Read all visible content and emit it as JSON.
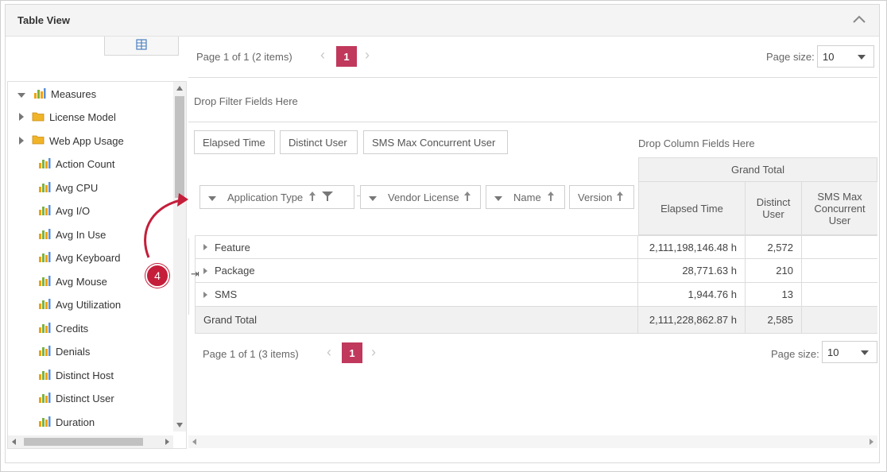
{
  "panel": {
    "title": "Table View"
  },
  "top_pager": {
    "info": "Page 1 of 1 (2 items)",
    "current_page": "1",
    "page_size_label": "Page size:",
    "page_size_value": "10"
  },
  "tree": {
    "items": [
      {
        "label": "Measures",
        "kind": "root-expanded",
        "icon": "bar-chart-icon"
      },
      {
        "label": "License Model",
        "kind": "folder",
        "icon": "folder-icon"
      },
      {
        "label": "Web App Usage",
        "kind": "folder",
        "icon": "folder-icon"
      },
      {
        "label": "Action Count",
        "kind": "measure",
        "icon": "bar-chart-icon"
      },
      {
        "label": "Avg CPU",
        "kind": "measure",
        "icon": "bar-chart-icon"
      },
      {
        "label": "Avg I/O",
        "kind": "measure",
        "icon": "bar-chart-icon"
      },
      {
        "label": "Avg In Use",
        "kind": "measure",
        "icon": "bar-chart-icon"
      },
      {
        "label": "Avg Keyboard",
        "kind": "measure",
        "icon": "bar-chart-icon"
      },
      {
        "label": "Avg Mouse",
        "kind": "measure",
        "icon": "bar-chart-icon"
      },
      {
        "label": "Avg Utilization",
        "kind": "measure",
        "icon": "bar-chart-icon"
      },
      {
        "label": "Credits",
        "kind": "measure",
        "icon": "bar-chart-icon"
      },
      {
        "label": "Denials",
        "kind": "measure",
        "icon": "bar-chart-icon"
      },
      {
        "label": "Distinct Host",
        "kind": "measure",
        "icon": "bar-chart-icon"
      },
      {
        "label": "Distinct User",
        "kind": "measure",
        "icon": "bar-chart-icon"
      },
      {
        "label": "Duration",
        "kind": "measure",
        "icon": "bar-chart-icon"
      }
    ]
  },
  "pivot": {
    "filter_drop": "Drop Filter Fields Here",
    "data_fields": [
      "Elapsed Time",
      "Distinct User",
      "SMS Max Concurrent User"
    ],
    "column_drop": "Drop Column Fields Here",
    "row_fields": [
      "Application Type",
      "Vendor License",
      "Name",
      "Version"
    ],
    "grand_total_header": "Grand Total",
    "column_headers": [
      "Elapsed Time",
      "Distinct User",
      "SMS Max Concurrent User"
    ],
    "rows": [
      {
        "label": "Feature",
        "values": [
          "2,111,198,146.48 h",
          "2,572",
          ""
        ]
      },
      {
        "label": "Package",
        "values": [
          "28,771.63 h",
          "210",
          ""
        ]
      },
      {
        "label": "SMS",
        "values": [
          "1,944.76 h",
          "13",
          ""
        ]
      }
    ],
    "grand_total": {
      "label": "Grand Total",
      "values": [
        "2,111,228,862.87 h",
        "2,585",
        ""
      ]
    }
  },
  "bottom_pager": {
    "info": "Page 1 of 1 (3 items)",
    "current_page": "1",
    "page_size_label": "Page size:",
    "page_size_value": "10"
  },
  "annotation": {
    "step": "4",
    "color": "#c41e3a"
  },
  "colors": {
    "accent": "#c0385c",
    "folder": "#f0b429",
    "header_bg": "#f1f1f1"
  }
}
